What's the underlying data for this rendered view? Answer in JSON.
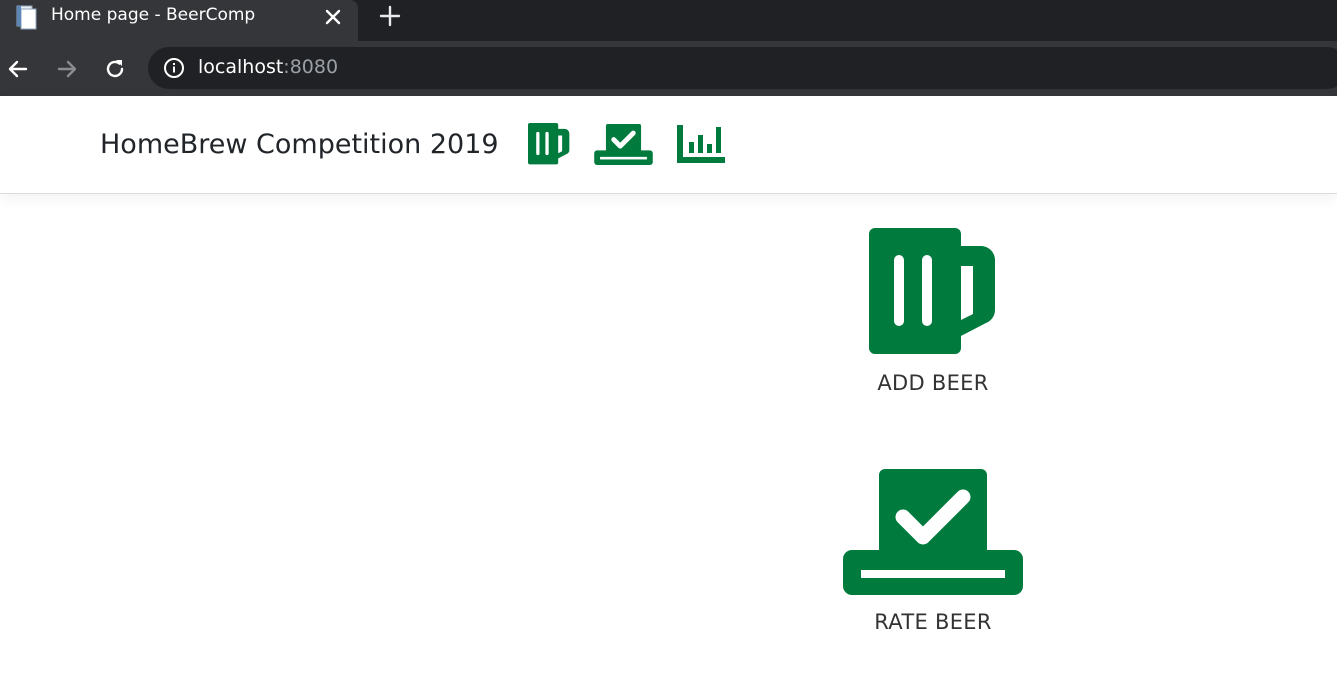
{
  "browser": {
    "tab_title": "Home page - BeerComp",
    "url_host": "localhost",
    "url_port": ":8080",
    "chrome_bg": "#35363a",
    "tabstrip_bg": "#202124"
  },
  "navbar": {
    "brand": "HomeBrew Competition 2019",
    "icons": [
      "beer-mug-icon",
      "vote-box-icon",
      "bar-chart-icon"
    ]
  },
  "actions": {
    "add_beer": "ADD BEER",
    "rate_beer": "RATE BEER"
  },
  "colors": {
    "accent": "#007a3d",
    "text": "#212529"
  }
}
